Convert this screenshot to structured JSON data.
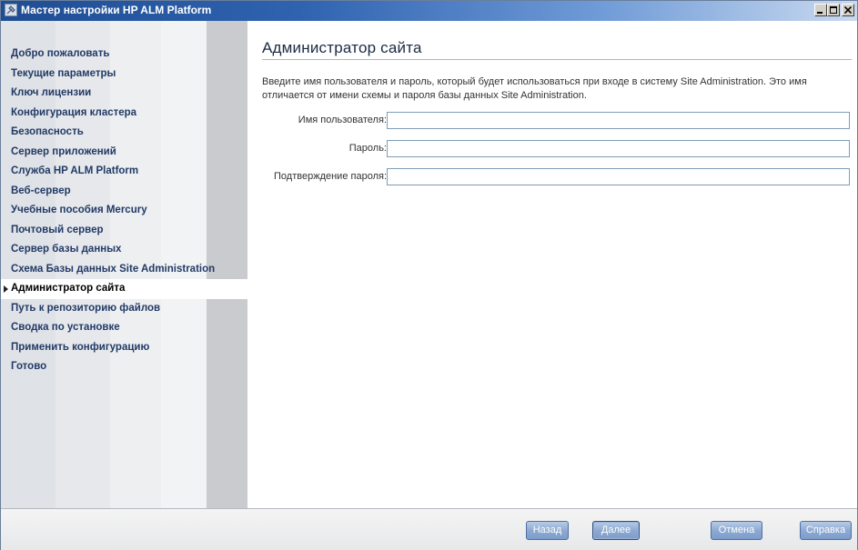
{
  "window": {
    "title": "Мастер настройки HP ALM Platform"
  },
  "sidebar": {
    "items": [
      {
        "label": "Добро пожаловать"
      },
      {
        "label": "Текущие параметры"
      },
      {
        "label": "Ключ лицензии"
      },
      {
        "label": "Конфигурация кластера"
      },
      {
        "label": "Безопасность"
      },
      {
        "label": "Сервер приложений"
      },
      {
        "label": "Служба HP ALM Platform"
      },
      {
        "label": "Веб-сервер"
      },
      {
        "label": "Учебные пособия Mercury"
      },
      {
        "label": "Почтовый сервер"
      },
      {
        "label": "Сервер базы данных"
      },
      {
        "label": "Схема Базы данных Site Administration"
      },
      {
        "label": "Администратор сайта",
        "active": true
      },
      {
        "label": "Путь к репозиторию файлов"
      },
      {
        "label": "Сводка по установке"
      },
      {
        "label": "Применить конфигурацию"
      },
      {
        "label": "Готово"
      }
    ]
  },
  "main": {
    "title": "Администратор сайта",
    "description": "Введите имя пользователя и пароль, который будет использоваться при входе в систему Site Administration. Это имя отличается от имени схемы и пароля базы данных Site Administration.",
    "fields": {
      "username": {
        "label": "Имя пользователя:",
        "value": ""
      },
      "password": {
        "label": "Пароль:",
        "value": ""
      },
      "confirm": {
        "label": "Подтверждение пароля:",
        "value": ""
      }
    }
  },
  "footer": {
    "back_label": "Назад",
    "next_label": "Далее",
    "cancel_label": "Отмена",
    "help_label": "Справка"
  },
  "colors": {
    "titlebar_start": "#1f4d93",
    "nav_text": "#223a66",
    "button_blue": "#8eaad2"
  }
}
